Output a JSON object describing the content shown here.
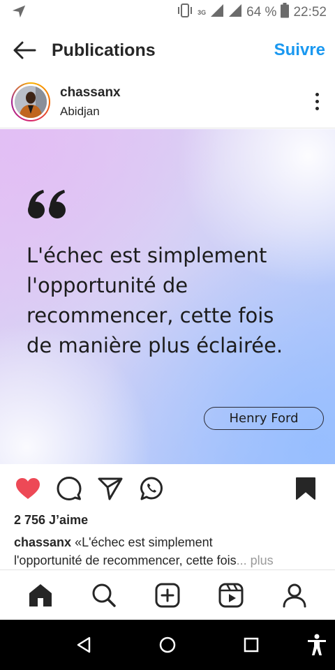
{
  "status_bar": {
    "network_label": "3G",
    "battery": "64 %",
    "time": "22:52"
  },
  "header": {
    "title": "Publications",
    "follow_label": "Suivre"
  },
  "post": {
    "username": "chassanx",
    "location": "Abidjan",
    "quote_lines": [
      "L'échec est simplement",
      "l'opportunité de",
      "recommencer, cette fois",
      "de manière plus éclairée."
    ],
    "author": "Henry Ford",
    "likes_text": "2 756 J’aime",
    "caption_user": "chassanx",
    "caption_line1": " «L'échec est simplement",
    "caption_line2": "l'opportunité de recommencer, cette fois",
    "caption_ellipsis": "...",
    "caption_more": " plus",
    "liked": true,
    "colors": {
      "accent_blue": "#1a98f0",
      "like_red": "#ed4956",
      "text": "#262626"
    }
  },
  "bottom_nav": {
    "icons": [
      "home-icon",
      "search-icon",
      "new-post-icon",
      "reels-icon",
      "profile-icon"
    ]
  },
  "android_nav": {
    "icons": [
      "back-triangle-icon",
      "home-circle-icon",
      "recents-square-icon",
      "accessibility-icon"
    ]
  }
}
